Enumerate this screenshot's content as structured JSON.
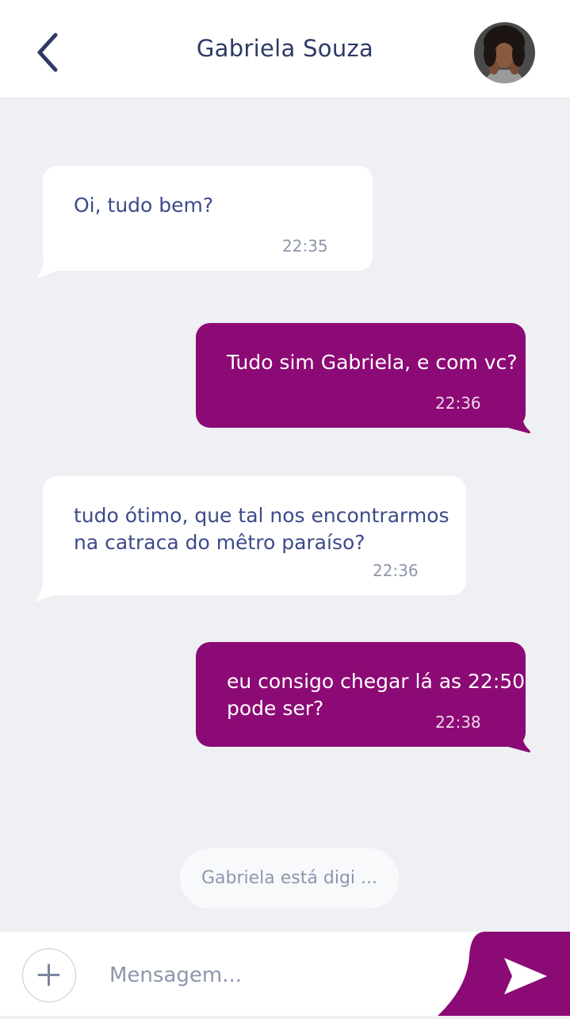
{
  "header": {
    "title": "Gabriela Souza",
    "back_icon": "chevron-left-icon",
    "avatar_icon": "contact-avatar"
  },
  "messages": [
    {
      "direction": "incoming",
      "text": "Oi, tudo bem?",
      "time": "22:35"
    },
    {
      "direction": "outgoing",
      "text": "Tudo sim Gabriela, e com vc?",
      "time": "22:36"
    },
    {
      "direction": "incoming",
      "text": "tudo ótimo, que tal nos encontrarmos\nna catraca do mêtro paraíso?",
      "time": "22:36"
    },
    {
      "direction": "outgoing",
      "text": "eu consigo chegar lá as 22:50\npode ser?",
      "time": "22:38"
    }
  ],
  "typing_indicator": "Gabriela está digi ...",
  "composer": {
    "placeholder": "Mensagem...",
    "add_icon": "plus-icon",
    "send_icon": "send-icon"
  },
  "colors": {
    "accent": "#8c0a75",
    "background": "#eef0f4",
    "incoming_text": "#3d4a8a",
    "title_text": "#2e3a66"
  }
}
